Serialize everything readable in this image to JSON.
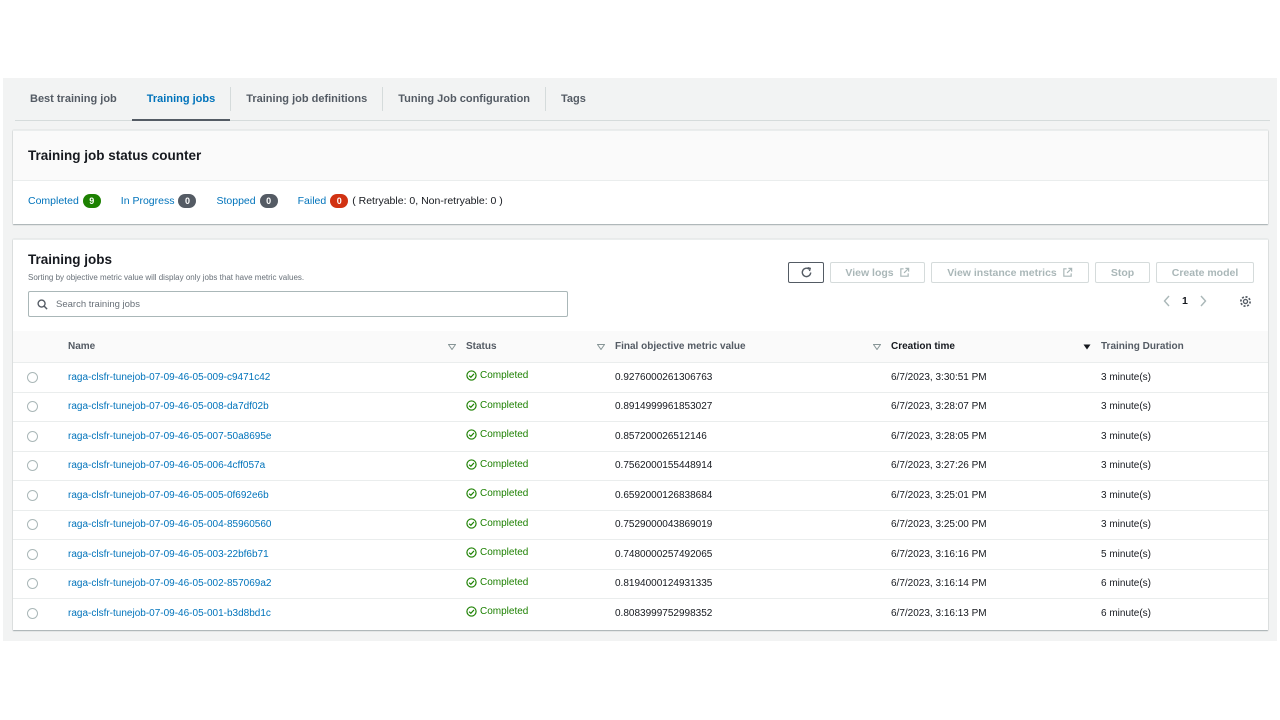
{
  "tabs": [
    {
      "label": "Best training job"
    },
    {
      "label": "Training jobs"
    },
    {
      "label": "Training job definitions"
    },
    {
      "label": "Tuning Job configuration"
    },
    {
      "label": "Tags"
    }
  ],
  "counter": {
    "title": "Training job status counter",
    "items": [
      {
        "label": "Completed",
        "count": "9",
        "color": "#1d8102"
      },
      {
        "label": "In Progress",
        "count": "0",
        "color": "#545b64"
      },
      {
        "label": "Stopped",
        "count": "0",
        "color": "#545b64"
      },
      {
        "label": "Failed",
        "count": "0",
        "color": "#d13212"
      }
    ],
    "failed_detail": "( Retryable: 0, Non-retryable: 0 )"
  },
  "jobs": {
    "title": "Training jobs",
    "subtitle": "Sorting by objective metric value will display only jobs that have metric values.",
    "search_placeholder": "Search training jobs",
    "buttons": {
      "view_logs": "View logs",
      "view_metrics": "View instance metrics",
      "stop": "Stop",
      "create_model": "Create model"
    },
    "page": "1",
    "columns": {
      "name": "Name",
      "status": "Status",
      "metric": "Final objective metric value",
      "created": "Creation time",
      "duration": "Training Duration"
    },
    "rows": [
      {
        "name": "raga-clsfr-tunejob-07-09-46-05-009-c9471c42",
        "status": "Completed",
        "metric": "0.9276000261306763",
        "created": "6/7/2023, 3:30:51 PM",
        "duration": "3 minute(s)"
      },
      {
        "name": "raga-clsfr-tunejob-07-09-46-05-008-da7df02b",
        "status": "Completed",
        "metric": "0.8914999961853027",
        "created": "6/7/2023, 3:28:07 PM",
        "duration": "3 minute(s)"
      },
      {
        "name": "raga-clsfr-tunejob-07-09-46-05-007-50a8695e",
        "status": "Completed",
        "metric": "0.857200026512146",
        "created": "6/7/2023, 3:28:05 PM",
        "duration": "3 minute(s)"
      },
      {
        "name": "raga-clsfr-tunejob-07-09-46-05-006-4cff057a",
        "status": "Completed",
        "metric": "0.7562000155448914",
        "created": "6/7/2023, 3:27:26 PM",
        "duration": "3 minute(s)"
      },
      {
        "name": "raga-clsfr-tunejob-07-09-46-05-005-0f692e6b",
        "status": "Completed",
        "metric": "0.6592000126838684",
        "created": "6/7/2023, 3:25:01 PM",
        "duration": "3 minute(s)"
      },
      {
        "name": "raga-clsfr-tunejob-07-09-46-05-004-85960560",
        "status": "Completed",
        "metric": "0.7529000043869019",
        "created": "6/7/2023, 3:25:00 PM",
        "duration": "3 minute(s)"
      },
      {
        "name": "raga-clsfr-tunejob-07-09-46-05-003-22bf6b71",
        "status": "Completed",
        "metric": "0.7480000257492065",
        "created": "6/7/2023, 3:16:16 PM",
        "duration": "5 minute(s)"
      },
      {
        "name": "raga-clsfr-tunejob-07-09-46-05-002-857069a2",
        "status": "Completed",
        "metric": "0.8194000124931335",
        "created": "6/7/2023, 3:16:14 PM",
        "duration": "6 minute(s)"
      },
      {
        "name": "raga-clsfr-tunejob-07-09-46-05-001-b3d8bd1c",
        "status": "Completed",
        "metric": "0.8083999752998352",
        "created": "6/7/2023, 3:16:13 PM",
        "duration": "6 minute(s)"
      }
    ]
  },
  "colors": {
    "link": "#0073bb",
    "success": "#1d8102",
    "neutral": "#545b64",
    "error": "#d13212"
  }
}
